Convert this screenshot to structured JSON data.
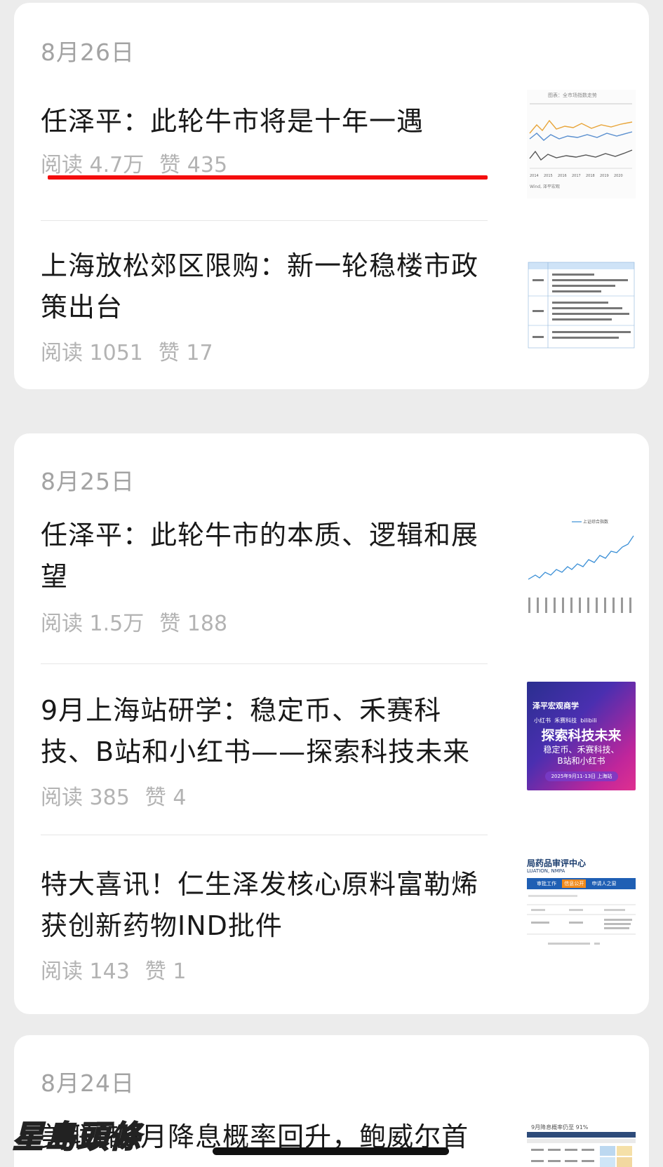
{
  "groups": [
    {
      "date": "8月26日",
      "items": [
        {
          "title": "任泽平：此轮牛市将是十年一遇",
          "reads": "阅读 4.7万",
          "likes": "赞 435",
          "thumb": "line-chart-multi"
        },
        {
          "title": "上海放松郊区限购：新一轮稳楼市政策出台",
          "reads": "阅读 1051",
          "likes": "赞 17",
          "thumb": "policy-table"
        }
      ]
    },
    {
      "date": "8月25日",
      "items": [
        {
          "title": "任泽平：此轮牛市的本质、逻辑和展望",
          "reads": "阅读 1.5万",
          "likes": "赞 188",
          "thumb": "line-chart-single",
          "thumb_legend": "上证综合指数"
        },
        {
          "title": "9月上海站研学：稳定币、禾赛科技、B站和小红书——探索科技未来",
          "reads": "阅读 385",
          "likes": "赞 4",
          "thumb": "event-poster",
          "poster": {
            "brand": "泽平宏观商学",
            "sub_a": "小红书",
            "sub_b": "禾赛科技",
            "sub_c": "bilibili",
            "headline": "探索科技未来",
            "line1": "稳定币、禾赛科技、",
            "line2": "B站和小红书",
            "date": "2025年9月11-13日",
            "place": "上海站"
          }
        },
        {
          "title": "特大喜讯！仁生泽发核心原料富勒烯获创新药物IND批件",
          "reads": "阅读 143",
          "likes": "赞 1",
          "thumb": "nmpa-page",
          "nmpa": {
            "head": "局药品审评中心",
            "sub": "LUATION, NMPA",
            "tab1": "审批工作",
            "tab2": "信息公开",
            "tab3": "申请人之窗"
          }
        }
      ]
    },
    {
      "date": "8月24日",
      "items": [
        {
          "title": "美联储9月降息概率回升，鲍威尔首",
          "thumb": "probability-table",
          "thumb_caption": "9月降息概率仍至 91%"
        }
      ]
    }
  ],
  "watermark": "星島頭條",
  "colors": {
    "highlight_underline": "#f40d0d",
    "meta": "#b3b3b3",
    "title": "#191919"
  }
}
